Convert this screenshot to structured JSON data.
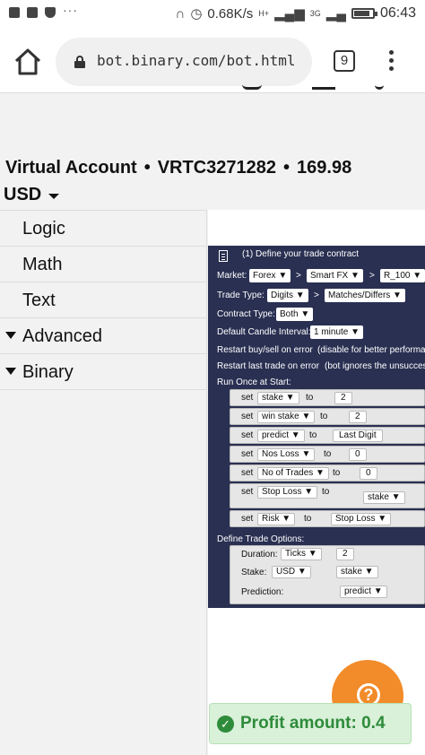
{
  "status_bar": {
    "speed": "0.68K/s",
    "net_labels": [
      "H+",
      "3G"
    ],
    "time": "06:43",
    "battery_level": 0.85,
    "icons": [
      "message-icon",
      "image-icon",
      "shield-icon",
      "headphones-icon",
      "alarm-icon",
      "signal-icon",
      "battery-icon"
    ]
  },
  "browser": {
    "url": "bot.binary.com/bot.html",
    "tab_count": "9"
  },
  "account": {
    "type": "Virtual Account",
    "id": "VRTC3271282",
    "balance": "169.98",
    "currency": "USD",
    "separator": "•"
  },
  "sidebar": {
    "categories": [
      {
        "label": "Logic"
      },
      {
        "label": "Math"
      },
      {
        "label": "Text"
      },
      {
        "label": "Advanced"
      },
      {
        "label": "Binary"
      }
    ]
  },
  "trade_block": {
    "title": "(1) Define your trade contract",
    "market_label": "Market:",
    "market": [
      "Forex ▼",
      "Smart FX ▼",
      "R_100 ▼"
    ],
    "gt": ">",
    "trade_type_label": "Trade Type:",
    "trade_type": [
      "Digits ▼",
      "Matches/Differs ▼"
    ],
    "contract_type_label": "Contract Type:",
    "contract_type": "Both ▼",
    "candle_label": "Default Candle Interval:",
    "candle": "1 minute ▼",
    "restart_error": "Restart buy/sell on error",
    "restart_error_note": "(disable for better performance)",
    "restart_last": "Restart last trade on error",
    "restart_last_note": "(bot ignores the unsuccessful)",
    "run_once": "Run Once at Start:",
    "set_word": "set",
    "to_word": "to",
    "sets": [
      {
        "var": "stake ▼",
        "value": "2"
      },
      {
        "var": "win stake ▼",
        "value": "2"
      },
      {
        "var": "predict ▼",
        "value": "Last Digit"
      },
      {
        "var": "Nos Loss ▼",
        "value": "0"
      },
      {
        "var": "No of Trades ▼",
        "value": "0"
      },
      {
        "var": "Stop Loss ▼",
        "value": "stake ▼"
      },
      {
        "var": "Risk ▼",
        "value": "Stop Loss ▼"
      }
    ],
    "define_options": "Define Trade Options:",
    "duration_label": "Duration:",
    "duration_unit": "Ticks ▼",
    "duration_value": "2",
    "stake_label": "Stake:",
    "stake_currency": "USD ▼",
    "stake_value": "stake ▼",
    "prediction_label": "Prediction:",
    "prediction_value": "predict ▼"
  },
  "help": {
    "glyph": "?"
  },
  "toast": {
    "text": "Profit amount: 0.4",
    "check": "✓"
  }
}
